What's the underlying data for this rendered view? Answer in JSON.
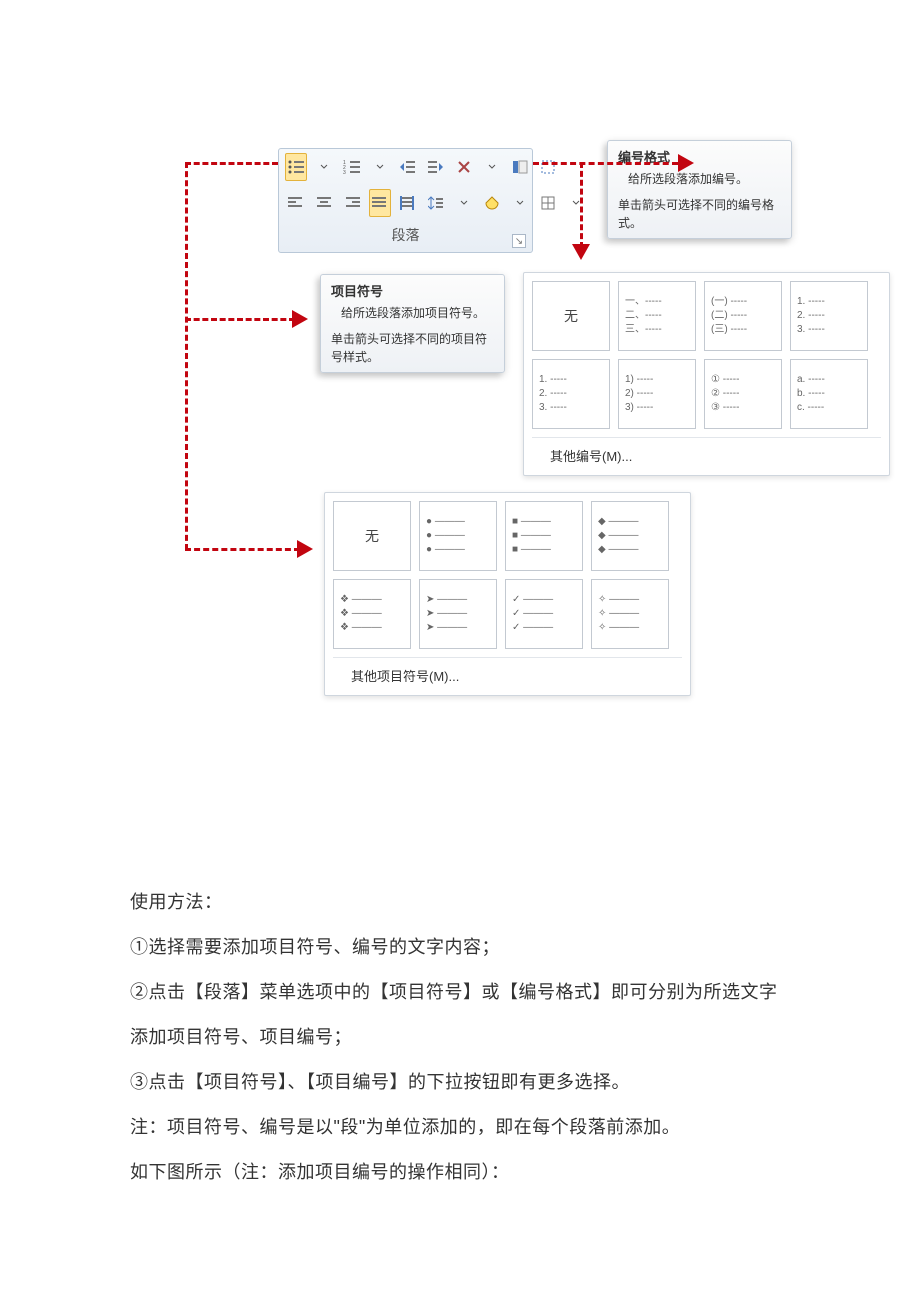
{
  "ribbon": {
    "group_label": "段落",
    "btn_bullets_name": "bullets",
    "btn_numbering_name": "numbering"
  },
  "tooltip_numbering": {
    "title": "编号格式",
    "body1": "给所选段落添加编号。",
    "body2": "单击箭头可选择不同的编号格式。"
  },
  "tooltip_bullets": {
    "title": "项目符号",
    "body1": "给所选段落添加项目符号。",
    "body2": "单击箭头可选择不同的项目符号样式。"
  },
  "gallery_num": {
    "none": "无",
    "cells": [
      "一、-----\n二、-----\n三、-----",
      "(一) -----\n(二) -----\n(三) -----",
      "1. -----\n2. -----\n3. -----",
      "1. -----\n2. -----\n3. -----",
      "1) -----\n2) -----\n3) -----",
      "① -----\n② -----\n③ -----",
      "a. -----\nb. -----\nc. -----"
    ],
    "footer": "其他编号(M)..."
  },
  "gallery_bul": {
    "none": "无",
    "cells": [
      "● ———\n● ———\n● ———",
      "■ ———\n■ ———\n■ ———",
      "◆ ———\n◆ ———\n◆ ———",
      "❖ ———\n❖ ———\n❖ ———",
      "➤ ———\n➤ ———\n➤ ———",
      "✓ ———\n✓ ———\n✓ ———",
      "✧ ———\n✧ ———\n✧ ———"
    ],
    "footer": "其他项目符号(M)..."
  },
  "explain": {
    "heading": "使用方法：",
    "p1": "①选择需要添加项目符号、编号的文字内容；",
    "p2": "②点击【段落】菜单选项中的【项目符号】或【编号格式】即可分别为所选文字添加项目符号、项目编号；",
    "p3": "③点击【项目符号】、【项目编号】的下拉按钮即有更多选择。",
    "p4": "注：项目符号、编号是以\"段\"为单位添加的，即在每个段落前添加。",
    "p5": "如下图所示（注：添加项目编号的操作相同）："
  }
}
